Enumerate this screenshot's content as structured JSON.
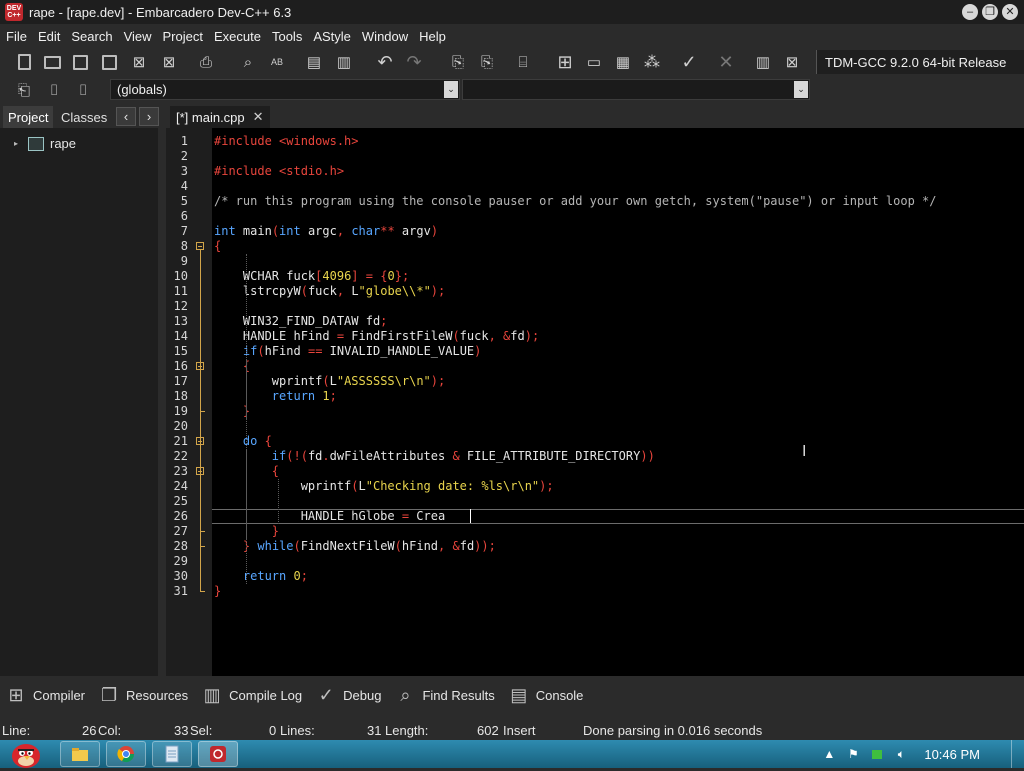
{
  "window": {
    "title": "rape - [rape.dev] - Embarcadero Dev-C++ 6.3",
    "app_icon_text": "DEV C++",
    "controls": [
      "minimize",
      "restore",
      "close"
    ]
  },
  "menu": [
    "File",
    "Edit",
    "Search",
    "View",
    "Project",
    "Execute",
    "Tools",
    "AStyle",
    "Window",
    "Help"
  ],
  "toolbar": {
    "compiler_label": "TDM-GCC 9.2.0 64-bit Release",
    "globals_combo": "(globals)",
    "function_combo": ""
  },
  "left_panel": {
    "tabs": [
      "Project",
      "Classes"
    ],
    "active_tab": "Project",
    "tree_items": [
      "rape"
    ]
  },
  "editor": {
    "tab_label": "[*] main.cpp",
    "lines": [
      "#include <windows.h>",
      "",
      "#include <stdio.h>",
      "",
      "/* run this program using the console pauser or add your own getch, system(\"pause\") or input loop */",
      "",
      "int main(int argc, char** argv)",
      "{",
      "",
      "    WCHAR fuck[4096] = {0};",
      "    lstrcpyW(fuck, L\"globe\\\\*\");",
      "",
      "    WIN32_FIND_DATAW fd;",
      "    HANDLE hFind = FindFirstFileW(fuck, &fd);",
      "    if(hFind == INVALID_HANDLE_VALUE)",
      "    {",
      "        wprintf(L\"ASSSSSS\\r\\n\");",
      "        return 1;",
      "    }",
      "",
      "    do {",
      "        if(!(fd.dwFileAttributes & FILE_ATTRIBUTE_DIRECTORY))",
      "        {",
      "            wprintf(L\"Checking date: %ls\\r\\n\");",
      "",
      "            HANDLE hGlobe = Crea",
      "        }",
      "    } while(FindNextFileW(hFind, &fd));",
      "",
      "    return 0;",
      "}"
    ],
    "current_line": 26,
    "colors": {
      "preprocessor": "#e8453c",
      "comment": "#b5b5b5",
      "keyword": "#58a6ff",
      "string": "#e8d44d",
      "number": "#e8d44d",
      "symbol": "#e8453c",
      "text": "#e6e6e6"
    }
  },
  "bottom_tabs": [
    "Compiler",
    "Resources",
    "Compile Log",
    "Debug",
    "Find Results",
    "Console"
  ],
  "status": {
    "line_label": "Line:",
    "line_value": "26",
    "col_label": "Col:",
    "col_value": "33",
    "sel_label": "Sel:",
    "sel_value": "0",
    "lines_label": "Lines:",
    "lines_value": "31",
    "length_label": "Length:",
    "length_value": "602",
    "mode": "Insert",
    "message": "Done parsing in 0.016 seconds"
  },
  "taskbar": {
    "clock": "10:46 PM",
    "pinned": [
      "explorer-icon",
      "chrome-icon",
      "notepad-icon",
      "devcpp-icon"
    ]
  }
}
